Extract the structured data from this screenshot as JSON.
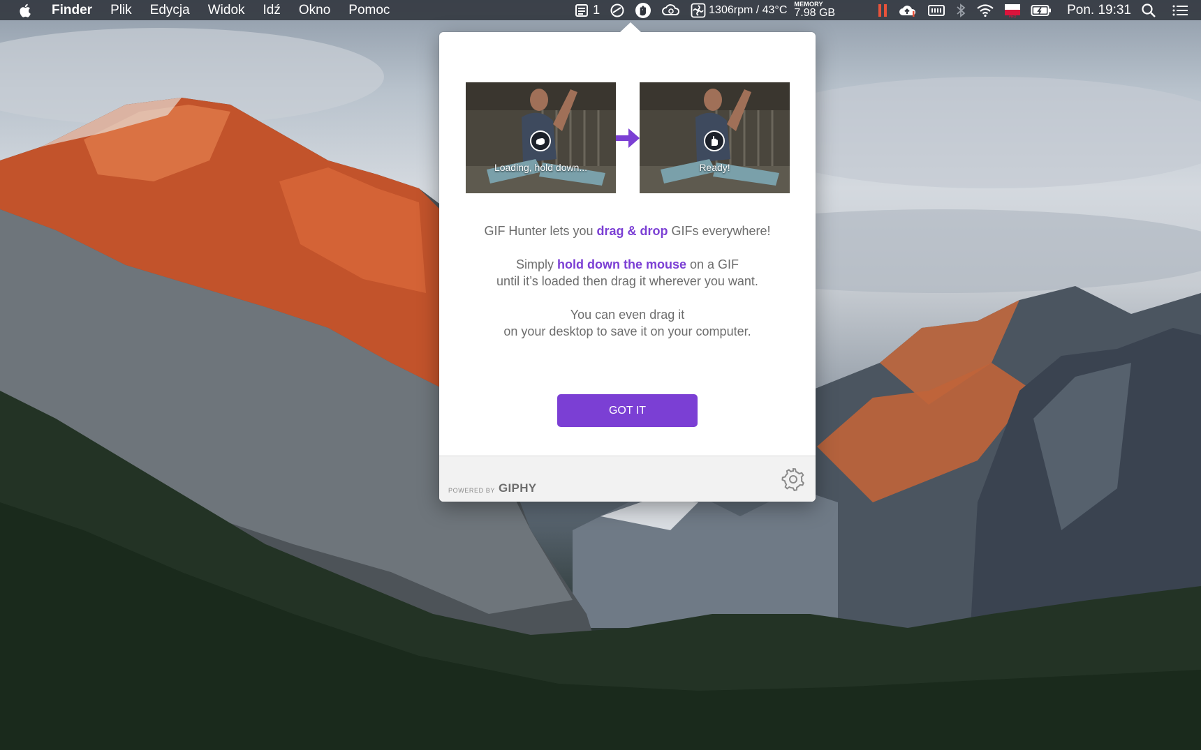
{
  "menubar": {
    "app_name": "Finder",
    "menus": [
      "Plik",
      "Edycja",
      "Widok",
      "Idź",
      "Okno",
      "Pomoc"
    ],
    "status": {
      "badge_count": "1",
      "fan_temp": "1306rpm / 43°C",
      "memory_label": "MEMORY",
      "memory_value": "7.98 GB",
      "clock": "Pon. 19:31"
    },
    "icons": [
      "apple-icon",
      "notes-icon",
      "donut-icon",
      "gif-hunter-icon",
      "cloud-sync-icon",
      "fan-icon",
      "pause-icon",
      "cloud-upload-icon",
      "memory-icon",
      "bluetooth-icon",
      "wifi-icon",
      "flag-icon",
      "battery-icon",
      "search-icon",
      "list-icon"
    ]
  },
  "popover": {
    "preview": {
      "loading_caption": "Loading, hold down...",
      "ready_caption": "Ready!"
    },
    "intro": {
      "line1_pre": "GIF Hunter lets you ",
      "line1_accent": "drag & drop",
      "line1_post": " GIFs everywhere!",
      "line2_pre": "Simply ",
      "line2_accent": "hold down the mouse",
      "line2_post": " on a GIF",
      "line3": "until it’s loaded then drag it wherever you want.",
      "line4": "You can even drag it",
      "line5": "on your desktop to save it on your computer."
    },
    "button_label": "GOT IT",
    "footer": {
      "powered_by": "POWERED BY",
      "brand": "GIPHY"
    }
  },
  "colors": {
    "accent": "#7b3fd4",
    "body_text": "#6d6d6d",
    "menubar_bg": "#30343c"
  }
}
